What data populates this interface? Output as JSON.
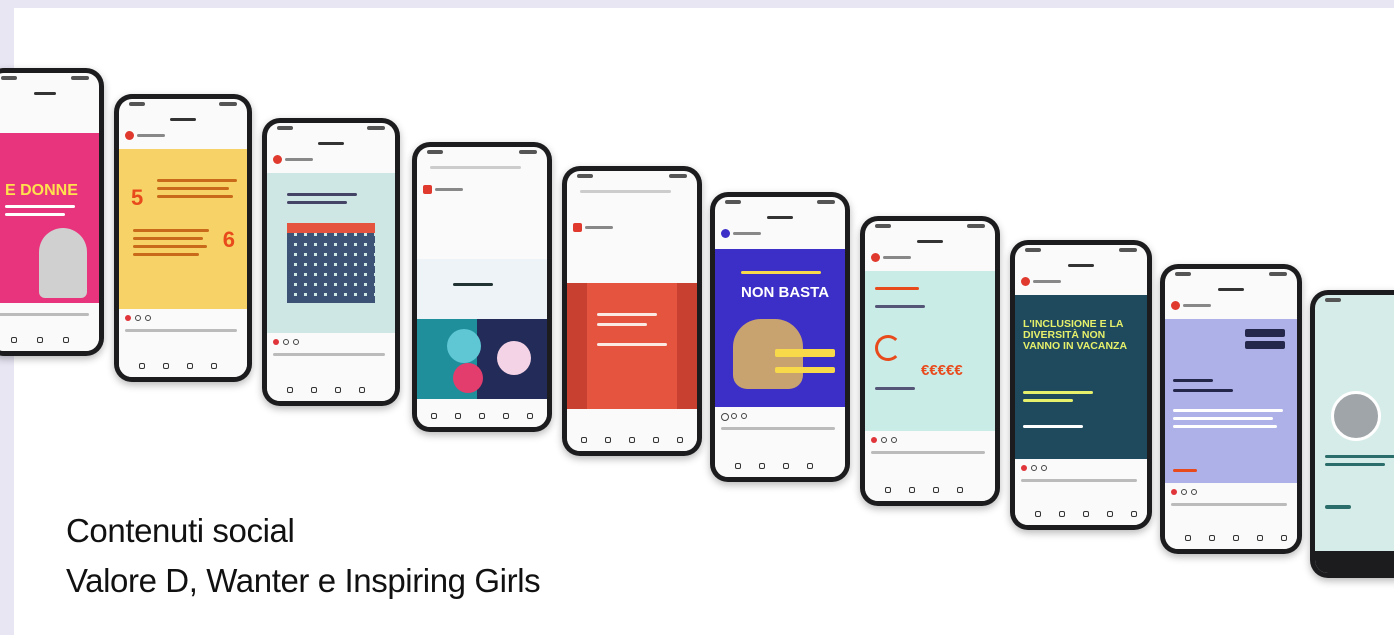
{
  "caption": {
    "line1": "Contenuti social",
    "line2": "Valore D, Wanter e Inspiring Girls"
  },
  "posts": [
    {
      "name": "phone-1",
      "background": "#e8347c",
      "text": "E DONNE"
    },
    {
      "name": "phone-2",
      "background": "#f7d267",
      "numbers": [
        "5",
        "6"
      ]
    },
    {
      "name": "phone-3",
      "background": "#cfe7e4"
    },
    {
      "name": "phone-4",
      "background": "#ffffff"
    },
    {
      "name": "phone-5",
      "background": "#e5543f"
    },
    {
      "name": "phone-6",
      "background": "#3c2fc7",
      "text": "NON BASTA"
    },
    {
      "name": "phone-7",
      "background": "#c9ece6",
      "text": "€€€€€"
    },
    {
      "name": "phone-8",
      "background": "#1f4a5e",
      "text": "L'INCLUSIONE E LA DIVERSITÀ NON VANNO IN VACANZA"
    },
    {
      "name": "phone-9",
      "background": "#aeb1e8"
    },
    {
      "name": "phone-10",
      "background": "#d6ece8"
    }
  ],
  "colors": {
    "accent_red": "#e84a1c",
    "phone_frame": "#1c1c1e",
    "band": "#e8e6f3"
  }
}
